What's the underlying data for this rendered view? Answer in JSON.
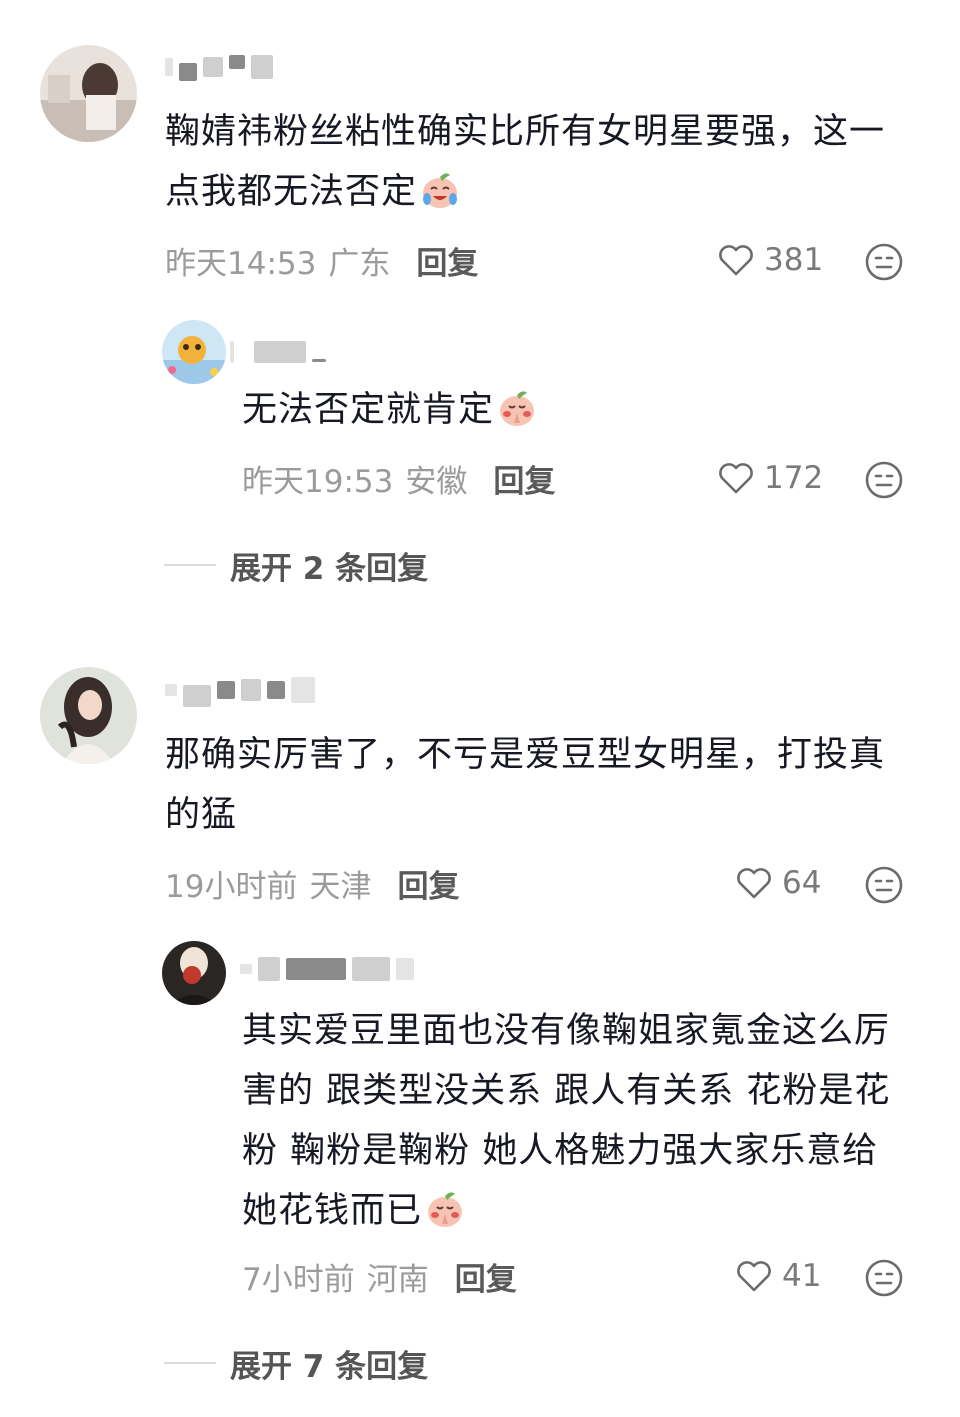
{
  "comments": [
    {
      "text_line1": "鞠婧祎粉丝粘性确实比所有女明星要强，这一",
      "text_line2": "点我都无法否定",
      "time": "昨天14:53",
      "location": "广东",
      "reply_label": "回复",
      "likes": "381",
      "emoji": "crying-laughing-peach",
      "replies": [
        {
          "text": "无法否定就肯定",
          "time": "昨天19:53",
          "location": "安徽",
          "reply_label": "回复",
          "likes": "172",
          "emoji": "praying-peach"
        }
      ],
      "expand_label": "展开 2 条回复"
    },
    {
      "text_line1": "那确实厉害了，不亏是爱豆型女明星，打投真",
      "text_line2": "的猛",
      "time": "19小时前",
      "location": "天津",
      "reply_label": "回复",
      "likes": "64",
      "replies": [
        {
          "text_line1": "其实爱豆里面也没有像鞠姐家氪金这么厉",
          "text_line2": "害的 跟类型没关系 跟人有关系 花粉是花",
          "text_line3": "粉 鞠粉是鞠粉 她人格魅力强大家乐意给",
          "text_line4": "她花钱而已",
          "time": "7小时前",
          "location": "河南",
          "reply_label": "回复",
          "likes": "41",
          "emoji": "praying-peach"
        }
      ],
      "expand_label": "展开 7 条回复"
    }
  ],
  "icons": {
    "like": "heart-outline-icon",
    "dislike": "neutral-face-icon"
  },
  "colors": {
    "text": "#161823",
    "meta": "#9b9b9b",
    "reply": "#5a5a5a",
    "like_count": "#7a7a7a"
  }
}
